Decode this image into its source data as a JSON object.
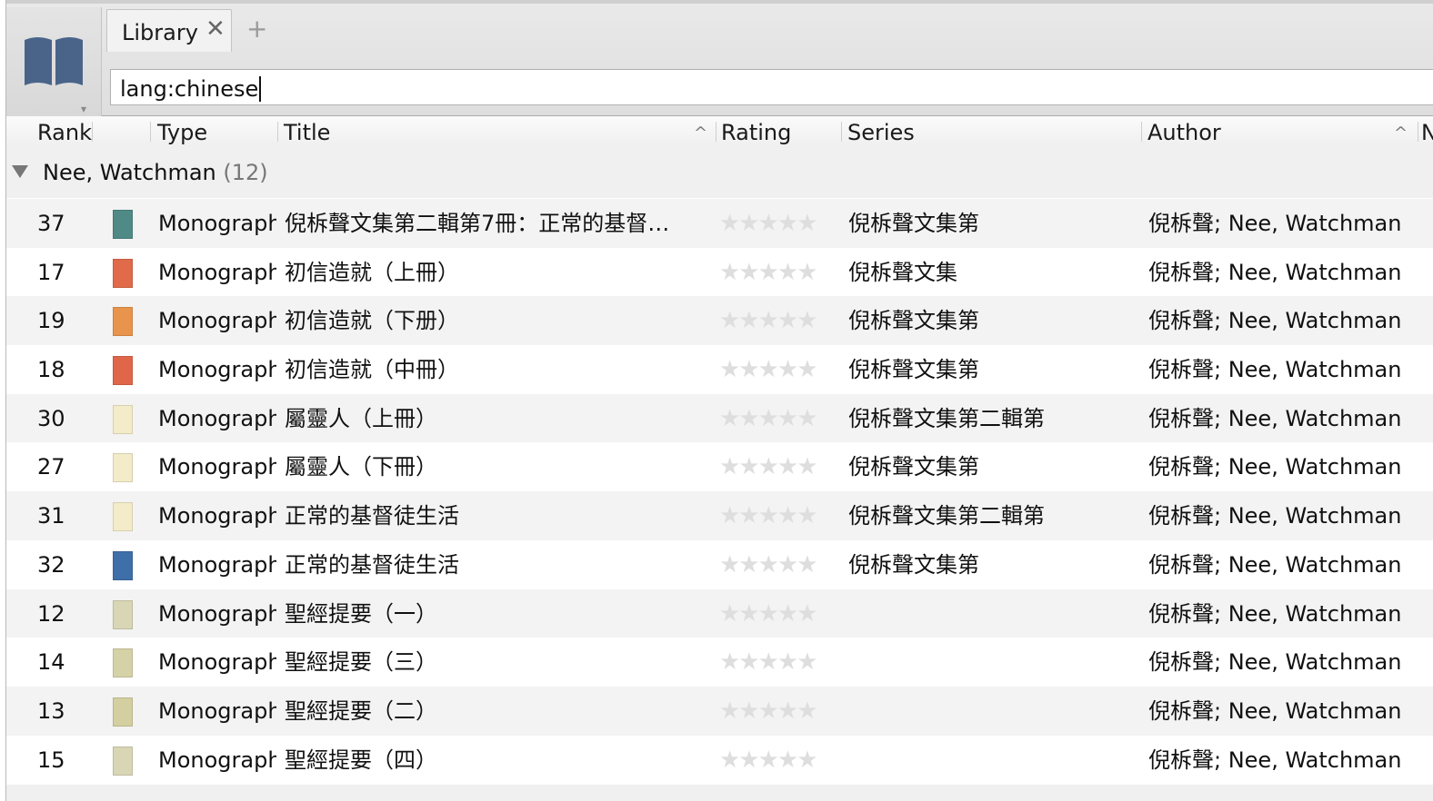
{
  "tabs": {
    "active_label": "Library",
    "close_glyph": "✕",
    "new_tab_glyph": "+"
  },
  "library_button": {
    "icon": "library-book-icon",
    "caret": "▾"
  },
  "search": {
    "value": "lang:chinese"
  },
  "columns": {
    "rank": "Rank",
    "type": "Type",
    "title": "Title",
    "rating": "Rating",
    "series": "Series",
    "author": "Author",
    "next": "N"
  },
  "sort_glyph": "^",
  "group": {
    "name": "Nee, Watchman",
    "count": "(12)"
  },
  "rating_stars": "★★★★★",
  "rows": [
    {
      "rank": "37",
      "type": "Monograph",
      "title": "倪柝聲文集第二輯第7冊：正常的基督…",
      "series": "倪柝聲文集第",
      "author": "倪柝聲; Nee, Watchman",
      "thumb_color": "#4f8a86"
    },
    {
      "rank": "17",
      "type": "Monograph",
      "title": "初信造就（上冊）",
      "series": "倪柝聲文集",
      "author": "倪柝聲; Nee, Watchman",
      "thumb_color": "#e06a4a"
    },
    {
      "rank": "19",
      "type": "Monograph",
      "title": "初信造就（下册）",
      "series": "倪柝聲文集第",
      "author": "倪柝聲; Nee, Watchman",
      "thumb_color": "#e8944c"
    },
    {
      "rank": "18",
      "type": "Monograph",
      "title": "初信造就（中冊）",
      "series": "倪柝聲文集第",
      "author": "倪柝聲; Nee, Watchman",
      "thumb_color": "#e0664a"
    },
    {
      "rank": "30",
      "type": "Monograph",
      "title": "屬靈人（上冊）",
      "series": "倪柝聲文集第二輯第",
      "author": "倪柝聲; Nee, Watchman",
      "thumb_color": "#f4ecc8"
    },
    {
      "rank": "27",
      "type": "Monograph",
      "title": "屬靈人（下冊）",
      "series": "倪柝聲文集第",
      "author": "倪柝聲; Nee, Watchman",
      "thumb_color": "#f4ecc8"
    },
    {
      "rank": "31",
      "type": "Monograph",
      "title": "正常的基督徒生活",
      "series": "倪柝聲文集第二輯第",
      "author": "倪柝聲; Nee, Watchman",
      "thumb_color": "#f4ecc8"
    },
    {
      "rank": "32",
      "type": "Monograph",
      "title": "正常的基督徒生活",
      "series": "倪柝聲文集第",
      "author": "倪柝聲; Nee, Watchman",
      "thumb_color": "#3f6fa8"
    },
    {
      "rank": "12",
      "type": "Monograph",
      "title": "聖經提要（一）",
      "series": "",
      "author": "倪柝聲; Nee, Watchman",
      "thumb_color": "#d8d6b4"
    },
    {
      "rank": "14",
      "type": "Monograph",
      "title": "聖經提要（三）",
      "series": "",
      "author": "倪柝聲; Nee, Watchman",
      "thumb_color": "#d6d2a8"
    },
    {
      "rank": "13",
      "type": "Monograph",
      "title": "聖經提要（二）",
      "series": "",
      "author": "倪柝聲; Nee, Watchman",
      "thumb_color": "#d4cfa0"
    },
    {
      "rank": "15",
      "type": "Monograph",
      "title": "聖經提要（四）",
      "series": "",
      "author": "倪柝聲; Nee, Watchman",
      "thumb_color": "#d8d6b4"
    }
  ]
}
